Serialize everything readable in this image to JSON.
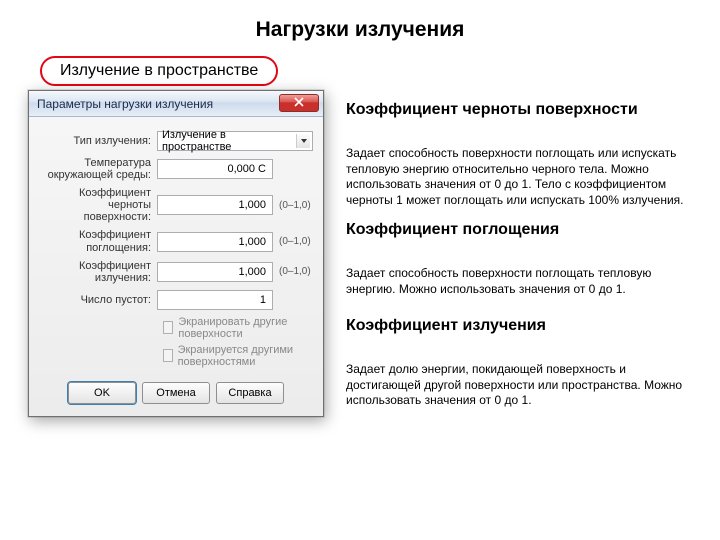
{
  "page_title": "Нагрузки излучения",
  "badge": "Излучение в пространстве",
  "dialog": {
    "title": "Параметры нагрузки излучения",
    "close_icon": "close",
    "type_label": "Тип излучения:",
    "type_value": "Излучение в пространстве",
    "ambient_label": "Температура окружающей среды:",
    "ambient_value": "0,000 C",
    "emissivity_label": "Коэффициент черноты поверхности:",
    "emissivity_value": "1,000",
    "absorb_label": "Коэффициент поглощения:",
    "absorb_value": "1,000",
    "radiate_label": "Коэффициент излучения:",
    "radiate_value": "1,000",
    "range_hint": "(0–1,0)",
    "voids_label": "Число пустот:",
    "voids_value": "1",
    "chk1": "Экранировать другие поверхности",
    "chk2": "Экранируется другими поверхностями",
    "ok": "OK",
    "cancel": "Отмена",
    "help": "Справка"
  },
  "sections": {
    "s1_title": "Коэффициент черноты поверхности",
    "s1_body": "Задает способность поверхности поглощать или испускать тепловую энергию относительно черного тела. Можно использовать значения от 0 до 1. Тело с коэффициентом черноты 1 может поглощать или испускать 100% излучения.",
    "s2_title": "Коэффициент поглощения",
    "s2_body": "Задает способность поверхности поглощать тепловую энергию. Можно использовать значения от 0 до 1.",
    "s3_title": "Коэффициент излучения",
    "s3_body": "Задает долю энергии, покидающей поверхность и достигающей другой поверхности или пространства. Можно использовать значения от 0 до 1."
  }
}
